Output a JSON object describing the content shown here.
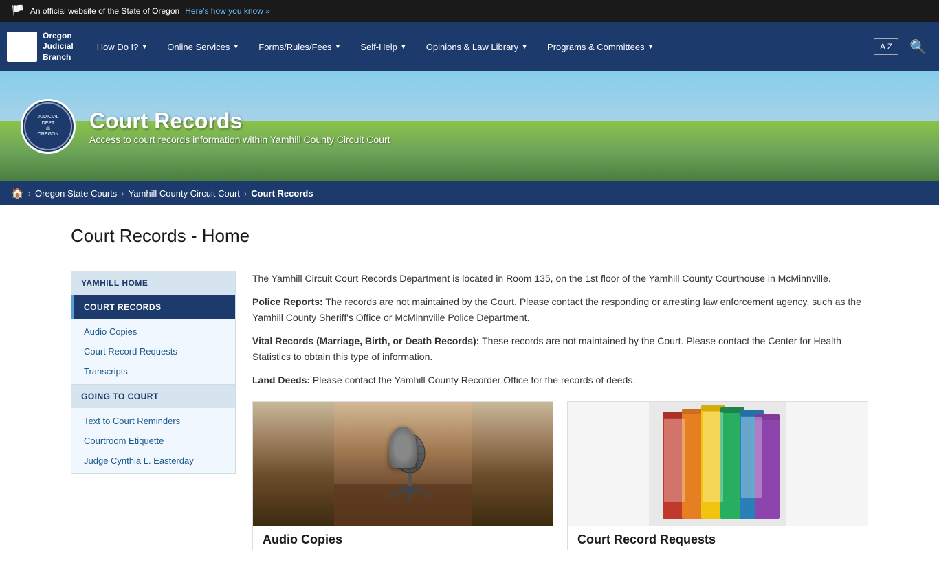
{
  "topBanner": {
    "flag": "🏳",
    "text": "An official website of the State of Oregon",
    "linkText": "Here's how you know »"
  },
  "nav": {
    "logo": {
      "icon": "⚖",
      "line1": "Oregon",
      "line2": "Judicial",
      "line3": "Branch"
    },
    "items": [
      {
        "label": "How Do I?",
        "hasDropdown": true
      },
      {
        "label": "Online Services",
        "hasDropdown": true
      },
      {
        "label": "Forms/Rules/Fees",
        "hasDropdown": true
      },
      {
        "label": "Self-Help",
        "hasDropdown": true
      },
      {
        "label": "Opinions & Law Library",
        "hasDropdown": true
      },
      {
        "label": "Programs & Committees",
        "hasDropdown": true
      }
    ],
    "translateLabel": "A  Z",
    "searchIcon": "🔍"
  },
  "hero": {
    "title": "Court Records",
    "subtitle": "Access to court records information within Yamhill County Circuit Court",
    "sealText": "JUDICIAL DEPARTMENT STATE OF OREGON"
  },
  "breadcrumb": {
    "homeIcon": "🏠",
    "items": [
      {
        "label": "Oregon State Courts",
        "href": "#"
      },
      {
        "label": "Yamhill County Circuit Court",
        "href": "#"
      },
      {
        "label": "Court Records",
        "current": true
      }
    ]
  },
  "pageTitle": "Court Records - Home",
  "sidebar": {
    "sections": [
      {
        "heading": "YAMHILL HOME",
        "active": false,
        "links": []
      },
      {
        "heading": "COURT RECORDS",
        "active": true,
        "links": [
          {
            "label": "Audio Copies"
          },
          {
            "label": "Court Record Requests"
          },
          {
            "label": "Transcripts"
          }
        ]
      },
      {
        "heading": "GOING TO COURT",
        "active": false,
        "links": [
          {
            "label": "Text to Court Reminders"
          },
          {
            "label": "Courtroom Etiquette"
          },
          {
            "label": "Judge Cynthia L. Easterday"
          }
        ]
      }
    ]
  },
  "mainContent": {
    "intro": "The Yamhill Circuit Court Records Department is located in Room 135, on the 1st floor of the Yamhill County Courthouse in McMinnville.",
    "policeReportsLabel": "Police Reports:",
    "policeReportsText": " The records are not maintained by the Court. Please contact the responding or arresting law enforcement agency, such as the Yamhill County Sheriff's Office or McMinnville Police Department.",
    "vitalRecordsLabel": "Vital Records (Marriage, Birth, or Death Records):",
    "vitalRecordsText": " These records are not maintained by the Court. Please contact the Center for Health Statistics to obtain this type of information.",
    "landDeedsLabel": "Land Deeds:",
    "landDeedsText": " Please contact the Yamhill County Recorder Office for the records of deeds.",
    "cards": [
      {
        "title": "Audio Copies",
        "imageType": "microphone"
      },
      {
        "title": "Court Record Requests",
        "imageType": "folders"
      }
    ]
  },
  "colors": {
    "navBg": "#1c3a6b",
    "sidebarActiveBg": "#1c3a6b",
    "sidebarHeadingBg": "#d6e4f0",
    "sidebarLinkBg": "#f0f7ff",
    "accent": "#5a9fd4",
    "folders": [
      "#c0392b",
      "#e67e22",
      "#f39c12",
      "#27ae60",
      "#2980b9",
      "#8e44ad",
      "#e74c3c",
      "#d35400"
    ]
  }
}
